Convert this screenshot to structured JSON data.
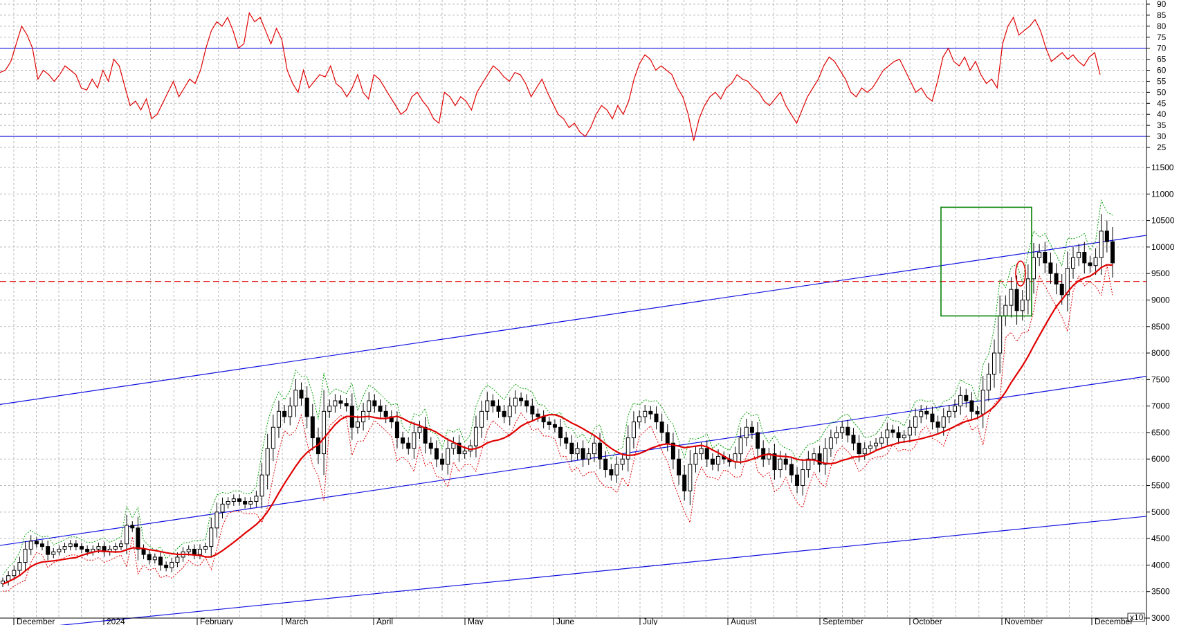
{
  "chart_data": [
    {
      "type": "line",
      "name": "RSI",
      "ylim": [
        25,
        90
      ],
      "yticks": [
        "90",
        "85",
        "80",
        "75",
        "70",
        "65",
        "60",
        "55",
        "50",
        "45",
        "40",
        "35",
        "30",
        "25"
      ],
      "reference_lines": [
        70,
        30
      ],
      "grid": true,
      "values": [
        59,
        60,
        64,
        72,
        80,
        76,
        70,
        56,
        60,
        58,
        55,
        58,
        62,
        60,
        58,
        52,
        51,
        56,
        52,
        60,
        55,
        65,
        62,
        53,
        44,
        46,
        42,
        47,
        38,
        40,
        45,
        50,
        55,
        48,
        52,
        56,
        54,
        60,
        70,
        78,
        82,
        80,
        84,
        78,
        70,
        72,
        86,
        82,
        84,
        78,
        72,
        79,
        74,
        60,
        54,
        50,
        60,
        52,
        55,
        58,
        57,
        62,
        54,
        52,
        48,
        52,
        58,
        50,
        47,
        58,
        56,
        52,
        48,
        44,
        40,
        42,
        48,
        50,
        46,
        43,
        38,
        36,
        50,
        48,
        44,
        48,
        46,
        42,
        50,
        54,
        58,
        62,
        60,
        57,
        55,
        59,
        58,
        54,
        48,
        52,
        56,
        50,
        45,
        40,
        38,
        34,
        36,
        32,
        30,
        34,
        40,
        44,
        42,
        38,
        44,
        40,
        46,
        56,
        63,
        67,
        65,
        60,
        62,
        60,
        58,
        52,
        48,
        40,
        28,
        38,
        44,
        48,
        50,
        47,
        52,
        54,
        58,
        56,
        55,
        52,
        50,
        46,
        44,
        47,
        50,
        44,
        40,
        36,
        42,
        48,
        52,
        56,
        62,
        66,
        64,
        60,
        56,
        50,
        48,
        52,
        50,
        52,
        56,
        60,
        62,
        64,
        65,
        60,
        55,
        50,
        52,
        48,
        46,
        55,
        66,
        70,
        64,
        62,
        66,
        60,
        64,
        58,
        54,
        56,
        52,
        72,
        80,
        84,
        76,
        78,
        80,
        83,
        78,
        70,
        64,
        66,
        68,
        65,
        67,
        64,
        62,
        66,
        68,
        58
      ]
    },
    {
      "type": "candlestick",
      "name": "Price",
      "ylim": [
        3000,
        11500
      ],
      "yticks": [
        "11500",
        "11000",
        "10500",
        "10000",
        "9500",
        "9000",
        "8500",
        "8000",
        "7500",
        "7000",
        "6500",
        "6000",
        "5500",
        "5000",
        "4500",
        "4000",
        "3500",
        "3000"
      ],
      "y_axis_multiplier": "x10",
      "horizontal_line": 9350,
      "channel_lines": [
        {
          "from": 7030,
          "to": 10220
        },
        {
          "from": 4370,
          "to": 7560
        },
        {
          "from": 2750,
          "to": 4920
        }
      ],
      "close": [
        3700,
        3800,
        3900,
        4050,
        4300,
        4450,
        4400,
        4350,
        4200,
        4250,
        4300,
        4350,
        4400,
        4350,
        4300,
        4250,
        4300,
        4350,
        4250,
        4300,
        4350,
        4400,
        4750,
        4700,
        4300,
        4200,
        4100,
        4150,
        4000,
        3950,
        4050,
        4150,
        4250,
        4300,
        4200,
        4300,
        4350,
        4700,
        5000,
        5150,
        5200,
        5250,
        5200,
        5150,
        5200,
        5300,
        5700,
        6200,
        6600,
        6900,
        6800,
        7000,
        7300,
        7150,
        6800,
        6400,
        6100,
        6900,
        7000,
        7100,
        7050,
        7000,
        6600,
        6700,
        6900,
        7100,
        7000,
        6900,
        6800,
        6700,
        6400,
        6300,
        6200,
        6500,
        6600,
        6300,
        6200,
        6000,
        5900,
        6200,
        6300,
        6100,
        6150,
        6250,
        6600,
        6900,
        7100,
        7000,
        6900,
        6800,
        7000,
        7150,
        7100,
        7000,
        6850,
        6800,
        6700,
        6650,
        6600,
        6400,
        6300,
        6100,
        6200,
        6000,
        6100,
        6300,
        6000,
        5800,
        5700,
        5900,
        6000,
        6400,
        6700,
        6800,
        6900,
        6850,
        6700,
        6500,
        6300,
        6000,
        5700,
        5400,
        5900,
        6100,
        6200,
        6000,
        5900,
        6050,
        6000,
        5950,
        6100,
        6400,
        6600,
        6500,
        6200,
        6000,
        6100,
        5800,
        6000,
        5900,
        5700,
        5500,
        5800,
        6000,
        6100,
        5900,
        6200,
        6400,
        6500,
        6600,
        6450,
        6300,
        6100,
        6200,
        6250,
        6300,
        6400,
        6550,
        6500,
        6400,
        6450,
        6600,
        6800,
        6900,
        6850,
        6700,
        6600,
        6800,
        6900,
        7000,
        7200,
        7100,
        6900,
        6850,
        7300,
        7600,
        8000,
        8700,
        8900,
        9200,
        8800,
        9000,
        9400,
        9800,
        9900,
        9700,
        9500,
        9300,
        9100,
        9600,
        9800,
        9900,
        9700,
        9650,
        9800,
        10300,
        10100,
        9700
      ]
    }
  ],
  "xaxis": {
    "months": [
      "December",
      "2024",
      "February",
      "March",
      "April",
      "May",
      "June",
      "July",
      "August",
      "September",
      "October",
      "November",
      "December"
    ]
  },
  "colors": {
    "rsi_line": "#e00000",
    "reference": "#1010e0",
    "ma": "#e00000",
    "upper_band": "#00a000",
    "lower_band": "#e00000",
    "highlight_box": "#008000",
    "grid": "#b8b8b8"
  }
}
